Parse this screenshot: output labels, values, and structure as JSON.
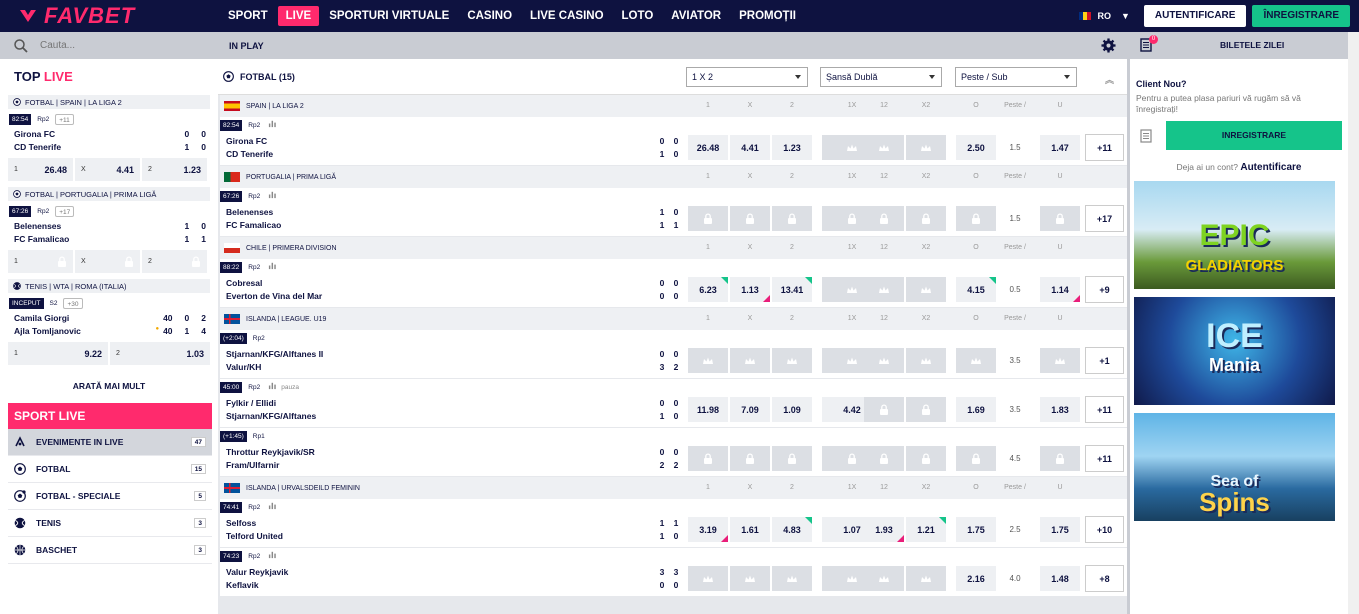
{
  "brand": {
    "name": "FAVBET",
    "accent": "#ff2a6d",
    "navy": "#0e1240",
    "green": "#15c48a"
  },
  "nav": [
    {
      "label": "SPORT",
      "active": false
    },
    {
      "label": "LIVE",
      "active": true
    },
    {
      "label": "SPORTURI VIRTUALE",
      "active": false
    },
    {
      "label": "CASINO",
      "active": false
    },
    {
      "label": "LIVE CASINO",
      "active": false
    },
    {
      "label": "LOTO",
      "active": false
    },
    {
      "label": "AVIATOR",
      "active": false
    },
    {
      "label": "PROMOȚII",
      "active": false
    }
  ],
  "header": {
    "lang": "RO",
    "login": "AUTENTIFICARE",
    "register": "ÎNREGISTRARE"
  },
  "search": {
    "placeholder": "Cauta..."
  },
  "top_live": {
    "title_a": "TOP ",
    "title_b": "LIVE",
    "cards": [
      {
        "league": "FOTBAL | SPAIN | LA LIGA 2",
        "time": "82:54",
        "tag": "Rp2",
        "more": "+11",
        "home": "Girona FC",
        "away": "CD Tenerife",
        "home_score": "0",
        "home_score2": "0",
        "away_score": "1",
        "away_score2": "0",
        "odds": [
          {
            "k": "1",
            "v": "26.48"
          },
          {
            "k": "X",
            "v": "4.41"
          },
          {
            "k": "2",
            "v": "1.23"
          }
        ]
      },
      {
        "league": "FOTBAL | PORTUGALIA | PRIMA LIGĂ",
        "time": "67:26",
        "tag": "Rp2",
        "more": "+17",
        "home": "Belenenses",
        "away": "FC Famalicao",
        "home_score": "1",
        "home_score2": "0",
        "away_score": "1",
        "away_score2": "1",
        "odds": [
          {
            "k": "1",
            "v": ""
          },
          {
            "k": "X",
            "v": ""
          },
          {
            "k": "2",
            "v": ""
          }
        ]
      },
      {
        "league": "TENIS | WTA | ROMA (ITALIA)",
        "time": "INCEPUT",
        "tag": "S2",
        "more": "+30",
        "home": "Camila Giorgi",
        "away": "Ajla Tomljanovic",
        "home_score": "40",
        "home_score2": "0",
        "home_score3": "2",
        "away_score": "40",
        "away_score2": "1",
        "away_score3": "4",
        "odds": [
          {
            "k": "1",
            "v": "9.22"
          },
          {
            "k": "2",
            "v": "1.03"
          }
        ]
      }
    ],
    "show_more": "ARATĂ MAI MULT"
  },
  "sport_live": {
    "title_a": "SPORT ",
    "title_b": "LIVE",
    "items": [
      {
        "label": "EVENIMENTE IN LIVE",
        "count": "47",
        "icon": "live-events-icon",
        "active": true
      },
      {
        "label": "FOTBAL",
        "count": "15",
        "icon": "football-icon",
        "active": false
      },
      {
        "label": "FOTBAL - SPECIALE",
        "count": "5",
        "icon": "football-special-icon",
        "active": false
      },
      {
        "label": "TENIS",
        "count": "3",
        "icon": "tennis-icon",
        "active": false
      },
      {
        "label": "BASCHET",
        "count": "3",
        "icon": "basketball-icon",
        "active": false
      }
    ]
  },
  "main": {
    "inplay": "IN PLAY",
    "sport_title": "FOTBAL (15)",
    "selects": [
      "1 X 2",
      "Șansă Dublă",
      "Peste / Sub"
    ],
    "col_headers": [
      "1",
      "X",
      "2",
      "1X",
      "12",
      "X2",
      "O",
      "Peste / Sub",
      "U"
    ],
    "leagues": [
      {
        "name": "SPAIN | LA LIGA 2",
        "flag": "spain",
        "matches": [
          {
            "time": "82:54",
            "tag": "Rp2",
            "stats": true,
            "note": "",
            "home": "Girona FC",
            "away": "CD Tenerife",
            "hs": [
              "0",
              "0"
            ],
            "as": [
              "1",
              "0"
            ],
            "odds": [
              "26.48",
              "4.41",
              "1.23",
              "c",
              "c",
              "",
              "2.50",
              "1.5",
              "1.47"
            ],
            "more": "+11",
            "tri": {}
          }
        ]
      },
      {
        "name": "PORTUGALIA | PRIMA LIGĂ",
        "flag": "portugal",
        "matches": [
          {
            "time": "67:26",
            "tag": "Rp2",
            "stats": true,
            "note": "",
            "home": "Belenenses",
            "away": "FC Famalicao",
            "hs": [
              "1",
              "0"
            ],
            "as": [
              "1",
              "1"
            ],
            "odds": [
              "l",
              "l",
              "l",
              "l",
              "l",
              "l",
              "l",
              "1.5",
              "l"
            ],
            "more": "+17",
            "tri": {}
          }
        ]
      },
      {
        "name": "CHILE | PRIMERA DIVISION",
        "flag": "chile",
        "matches": [
          {
            "time": "88:22",
            "tag": "Rp2",
            "stats": true,
            "note": "",
            "home": "Cobresal",
            "away": "Everton de Vina del Mar",
            "hs": [
              "0",
              "0"
            ],
            "as": [
              "0",
              "0"
            ],
            "odds": [
              "6.23",
              "1.13",
              "13.41",
              "c",
              "c",
              "",
              "4.15",
              "0.5",
              "1.14"
            ],
            "more": "+9",
            "tri": {
              "0": "g",
              "1": "p",
              "2": "g",
              "6": "g",
              "8": "p"
            }
          }
        ]
      },
      {
        "name": "ISLANDA | LEAGUE. U19",
        "flag": "iceland",
        "matches": [
          {
            "time": "(+2:04)",
            "tag": "Rp2",
            "stats": false,
            "note": "",
            "home": "Stjarnan/KFG/Alftanes II",
            "away": "Valur/KH",
            "hs": [
              "0",
              "0"
            ],
            "as": [
              "3",
              "2"
            ],
            "odds": [
              "c",
              "c",
              "c",
              "c",
              "c",
              "c",
              "c",
              "3.5",
              "c"
            ],
            "more": "+1",
            "tri": {}
          },
          {
            "time": "45:00",
            "tag": "Rp2",
            "stats": true,
            "note": "pauza",
            "home": "Fylkir / Ellidi",
            "away": "Stjarnan/KFG/Alftanes",
            "hs": [
              "0",
              "0"
            ],
            "as": [
              "1",
              "0"
            ],
            "odds": [
              "11.98",
              "7.09",
              "1.09",
              "4.42",
              "l",
              "l",
              "1.69",
              "3.5",
              "1.83"
            ],
            "more": "+11",
            "tri": {}
          },
          {
            "time": "(+1:45)",
            "tag": "Rp1",
            "stats": false,
            "note": "",
            "home": "Throttur Reykjavik/SR",
            "away": "Fram/Ulfarnir",
            "hs": [
              "0",
              "0"
            ],
            "as": [
              "2",
              "2"
            ],
            "odds": [
              "l",
              "l",
              "l",
              "l",
              "l",
              "l",
              "l",
              "4.5",
              "l"
            ],
            "more": "+11",
            "tri": {}
          }
        ]
      },
      {
        "name": "ISLANDA | URVALSDEILD FEMININ",
        "flag": "iceland",
        "matches": [
          {
            "time": "74:41",
            "tag": "Rp2",
            "stats": true,
            "note": "",
            "home": "Selfoss",
            "away": "Telford United",
            "hs": [
              "1",
              "1"
            ],
            "as": [
              "1",
              "0"
            ],
            "odds": [
              "3.19",
              "1.61",
              "4.83",
              "1.07",
              "1.93",
              "1.21",
              "1.75",
              "2.5",
              "1.75"
            ],
            "more": "+10",
            "tri": {
              "0": "p",
              "2": "g",
              "4": "p",
              "5": "g"
            }
          },
          {
            "time": "74:23",
            "tag": "Rp2",
            "stats": true,
            "note": "",
            "home": "Valur Reykjavik",
            "away": "Keflavik",
            "hs": [
              "3",
              "3"
            ],
            "as": [
              "0",
              "0"
            ],
            "odds": [
              "c",
              "c",
              "c",
              "c",
              "c",
              "c",
              "2.16",
              "4.0",
              "1.48"
            ],
            "more": "+8",
            "tri": {}
          }
        ]
      }
    ]
  },
  "betslip": {
    "title": "BILETELE ZILEI",
    "count": "0",
    "client_title": "Client Nou?",
    "client_text": "Pentru a putea plasa pariuri vă rugăm să vă înregistrați!",
    "register": "INREGISTRARE",
    "have_account": "Deja ai un cont?",
    "login_link": "Autentificare",
    "banners": [
      {
        "l1": "EPIC",
        "l2": "GLADIATORS"
      },
      {
        "l1": "ICE",
        "l2": "Mania"
      },
      {
        "l1": "Sea of",
        "l2": "Spins"
      }
    ]
  }
}
